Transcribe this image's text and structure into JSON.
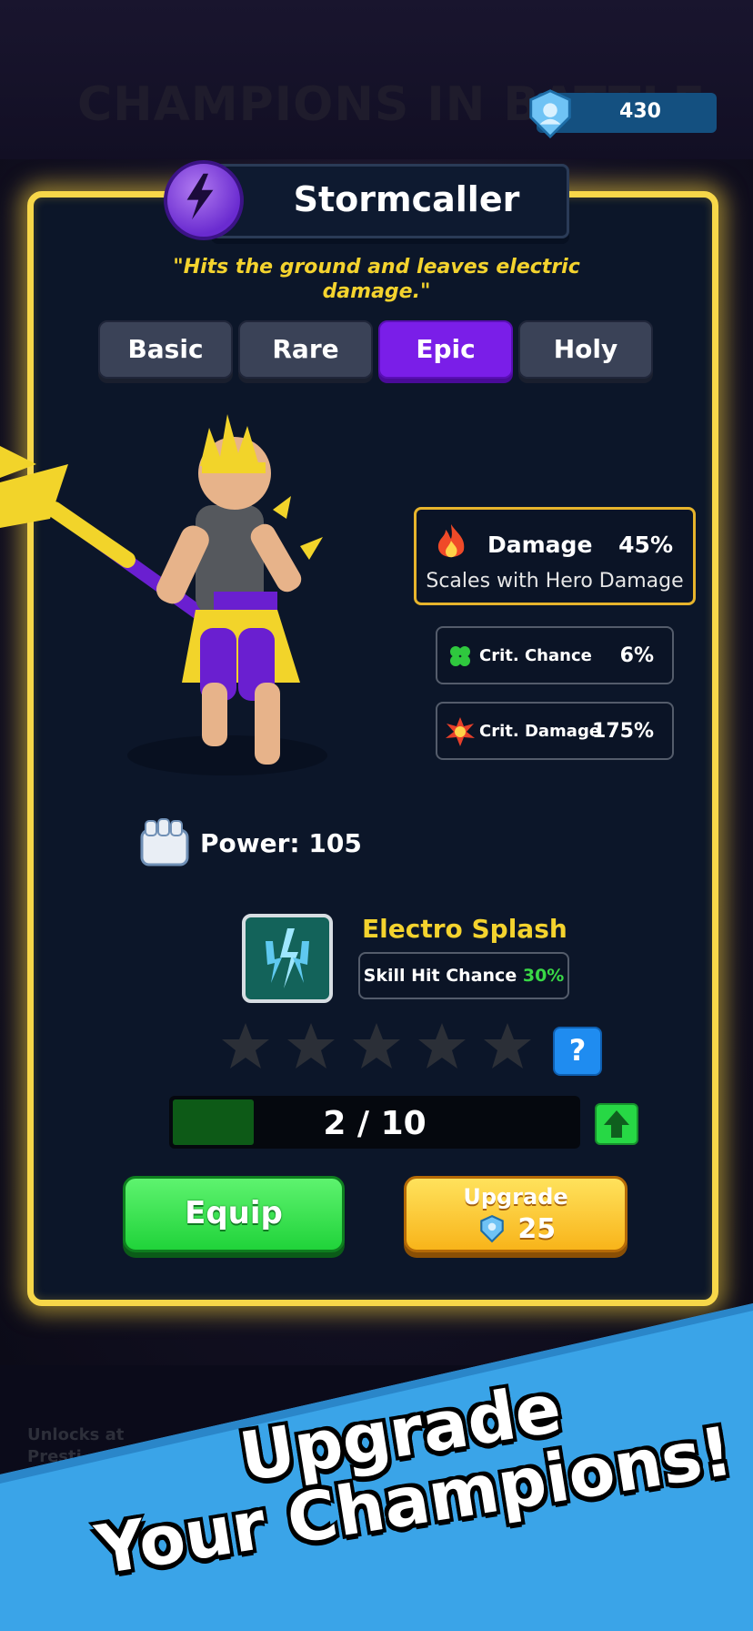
{
  "header": {
    "title": "CHAMPIONS IN BATTLE",
    "currency_icon": "shield-gem-icon",
    "currency_value": "430"
  },
  "champion": {
    "name": "Stormcaller",
    "class_icon": "lightning-bolt-icon",
    "quote": "\"Hits the ground and leaves electric damage.\""
  },
  "rarity_tabs": [
    {
      "label": "Basic",
      "active": false
    },
    {
      "label": "Rare",
      "active": false
    },
    {
      "label": "Epic",
      "active": true
    },
    {
      "label": "Holy",
      "active": false
    }
  ],
  "stats": {
    "damage": {
      "icon": "flame-icon",
      "label": "Damage",
      "value": "45%",
      "note": "Scales with Hero Damage"
    },
    "crit_chance": {
      "icon": "clover-icon",
      "label": "Crit. Chance",
      "value": "6%"
    },
    "crit_damage": {
      "icon": "explosion-icon",
      "label": "Crit. Damage",
      "value": "175%"
    }
  },
  "power": {
    "icon": "fist-icon",
    "label": "Power: 105"
  },
  "skill": {
    "icon": "electric-splash-icon",
    "name": "Electro Splash",
    "chance_label": "Skill Hit Chance",
    "chance_value": "30%"
  },
  "stars": {
    "filled": 0,
    "total": 5
  },
  "help_label": "?",
  "progress": {
    "current": 2,
    "max": 10,
    "text": "2 / 10",
    "fraction": 0.2
  },
  "buttons": {
    "equip": "Equip",
    "upgrade": "Upgrade",
    "upgrade_cost": "25"
  },
  "locked_hint": "Unlocks at\nPresti",
  "banner": {
    "line1": "Upgrade",
    "line2": "Your Champions!"
  },
  "colors": {
    "accent_gold": "#f7d749",
    "epic_purple": "#7a1ee8",
    "equip_green": "#20d33a",
    "upgrade_yellow": "#f8b41a",
    "banner_blue": "#3aa4e8"
  }
}
